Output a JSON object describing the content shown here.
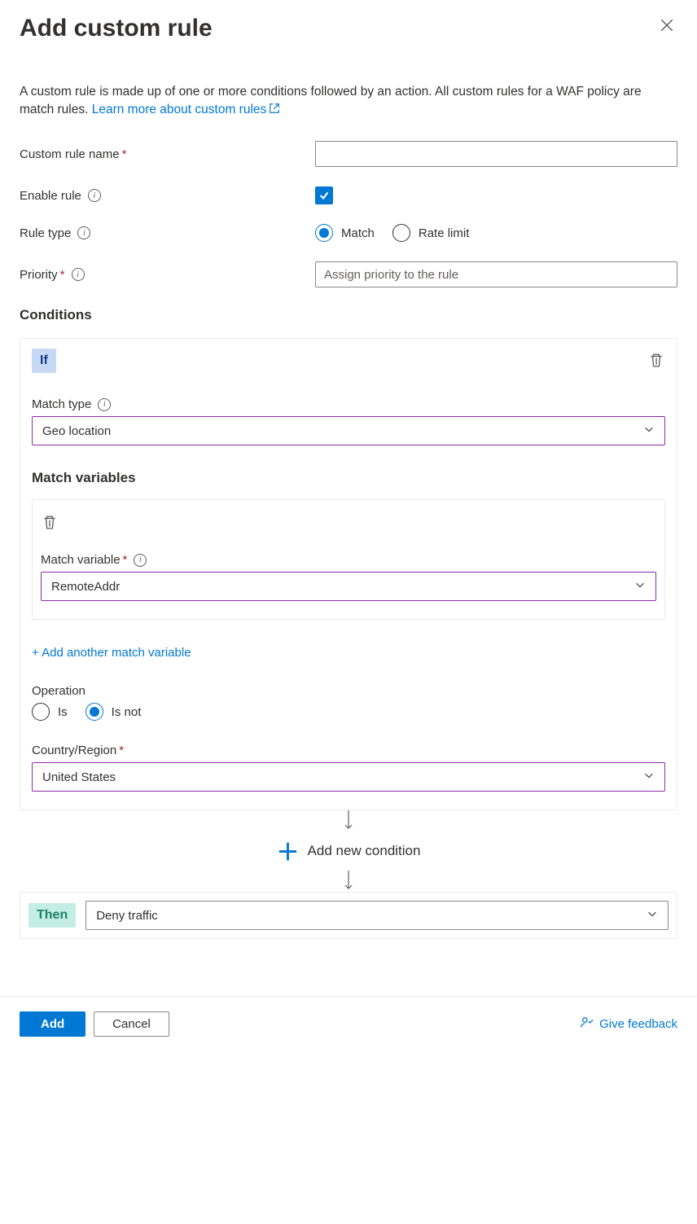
{
  "header": {
    "title": "Add custom rule"
  },
  "description": {
    "text": "A custom rule is made up of one or more conditions followed by an action. All custom rules for a WAF policy are match rules. ",
    "link_text": "Learn more about custom rules"
  },
  "form": {
    "name_label": "Custom rule name",
    "enable_label": "Enable rule",
    "ruletype_label": "Rule type",
    "ruletype_options": {
      "match": "Match",
      "ratelimit": "Rate limit"
    },
    "priority_label": "Priority",
    "priority_placeholder": "Assign priority to the rule"
  },
  "conditions": {
    "heading": "Conditions",
    "if_label": "If",
    "match_type_label": "Match type",
    "match_type_value": "Geo location",
    "match_vars_heading": "Match variables",
    "match_var_label": "Match variable",
    "match_var_value": "RemoteAddr",
    "add_var_link": "+ Add another match variable",
    "operation_label": "Operation",
    "operation_options": {
      "is": "Is",
      "isnot": "Is not"
    },
    "country_label": "Country/Region",
    "country_value": "United States",
    "add_condition_label": "Add new condition"
  },
  "then": {
    "label": "Then",
    "action_value": "Deny traffic"
  },
  "footer": {
    "add": "Add",
    "cancel": "Cancel",
    "feedback": "Give feedback"
  }
}
